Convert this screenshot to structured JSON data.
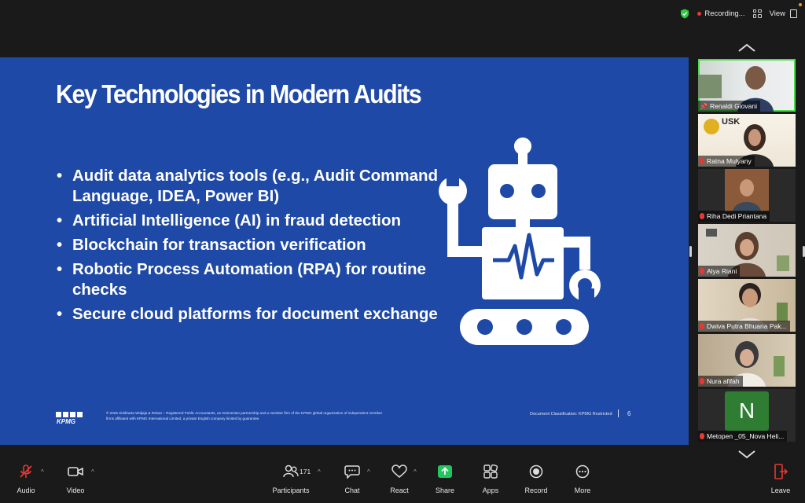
{
  "topbar": {
    "recording_label": "Recording...",
    "view_label": "View"
  },
  "slide": {
    "title": "Key Technologies in Modern Audits",
    "bullets": [
      "Audit data analytics tools (e.g., Audit Command Language, IDEA, Power BI)",
      "Artificial Intelligence (AI) in fraud detection",
      "Blockchain for transaction verification",
      "Robotic Process Automation (RPA) for routine checks",
      "Secure cloud platforms for document exchange"
    ],
    "footer": {
      "logo": "KPMG",
      "copyright": "© 2025 Siddharta Widjaja & Rekan – Registered Public Accountants, an Indonesian partnership and a member firm of the KPMG global organization of independent member firms affiliated with KPMG International Limited, a private English company limited by guarantee.",
      "classification": "Document Classification: KPMG Restricted",
      "page": "6"
    },
    "colors": {
      "background": "#1e49a6"
    }
  },
  "participants": [
    {
      "name": "Renaldi Giovani",
      "active": true,
      "pinned": true
    },
    {
      "name": "Ratna Mulyany",
      "muted": true,
      "bg_text": "USK"
    },
    {
      "name": "Riha Dedi Priantana",
      "muted": true
    },
    {
      "name": "Alya Riani",
      "muted": true
    },
    {
      "name": "Dwiva Putra Bhuana Pak...",
      "muted": true
    },
    {
      "name": "Nura afifah",
      "muted": true
    },
    {
      "name": "Metopen _05_Nova Heli...",
      "muted": true,
      "initial": "N"
    }
  ],
  "toolbar": {
    "audio": "Audio",
    "video": "Video",
    "participants": "Participants",
    "participants_count": "171",
    "chat": "Chat",
    "react": "React",
    "share": "Share",
    "apps": "Apps",
    "record": "Record",
    "more": "More",
    "leave": "Leave"
  }
}
